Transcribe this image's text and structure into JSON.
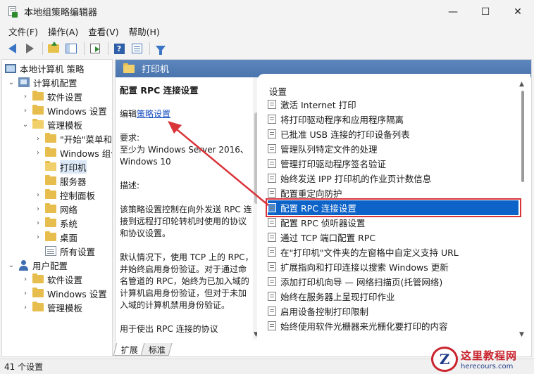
{
  "window": {
    "title": "本地组策略编辑器",
    "controls": {
      "minimize": "—",
      "maximize": "☐",
      "close": "✕"
    }
  },
  "menu": [
    "文件(F)",
    "操作(A)",
    "查看(V)",
    "帮助(H)"
  ],
  "toolbar_icons": [
    "back-icon",
    "forward-icon",
    "up-folder-icon",
    "show-pane-icon",
    "export-icon",
    "help-icon",
    "view-icon",
    "filter-icon"
  ],
  "tree": {
    "root": "本地计算机 策略",
    "computer_config": "计算机配置",
    "software_settings": "软件设置",
    "windows_settings": "Windows 设置",
    "admin_templates": "管理模板",
    "start_menu": "\"开始\"菜单和",
    "windows_components": "Windows 组件",
    "printers": "打印机",
    "server": "服务器",
    "control_panel": "控制面板",
    "network": "网络",
    "system": "系统",
    "desktop": "桌面",
    "all_settings": "所有设置",
    "user_config": "用户配置",
    "u_software_settings": "软件设置",
    "u_windows_settings": "Windows 设置",
    "u_admin_templates": "管理模板"
  },
  "header": {
    "title": "打印机"
  },
  "description": {
    "title": "配置 RPC 连接设置",
    "edit_prefix": "编辑",
    "edit_link": "策略设置",
    "requirements_label": "要求:",
    "requirements_text": "至少为 Windows Server 2016、Windows 10",
    "desc_label": "描述:",
    "desc_p1": "该策略设置控制在向外发送 RPC 连接到远程打印轮转机时使用的协议和协议设置。",
    "desc_p2": "默认情况下，使用 TCP 上的 RPC，并始终启用身份验证。对于通过命名管道的 RPC，始终为已加入域的计算机启用身份验证，但对于未加入域的计算机禁用身份验证。",
    "desc_p3": "用于使出 RPC 连接的协议"
  },
  "list": {
    "header": "设置",
    "items": [
      "激活 Internet 打印",
      "将打印驱动程序和应用程序隔离",
      "已批准 USB 连接的打印设备列表",
      "管理队列特定文件的处理",
      "管理打印驱动程序签名验证",
      "始终发送 IPP 打印机的作业页计数信息",
      "配置重定向防护",
      "配置 RPC 连接设置",
      "配置 RPC 侦听器设置",
      "通过 TCP 端口配置 RPC",
      "在\"打印机\"文件夹的左窗格中自定义支持 URL",
      "扩展指向和打印连接以搜索 Windows 更新",
      "添加打印机向导 — 网络扫描页(托管网络)",
      "始终在服务器上呈现打印作业",
      "启用设备控制打印限制",
      "始终使用软件光栅器来光栅化要打印的内容"
    ],
    "selected_index": 7
  },
  "tabs": [
    "扩展",
    "标准"
  ],
  "status": "41 个设置",
  "watermark": {
    "logo": "Z",
    "name": "这里教程网",
    "url": "herecours.com"
  },
  "colors": {
    "accent": "#0e63c8",
    "header_band": "#4a74ad",
    "annotation": "#d9343a"
  }
}
